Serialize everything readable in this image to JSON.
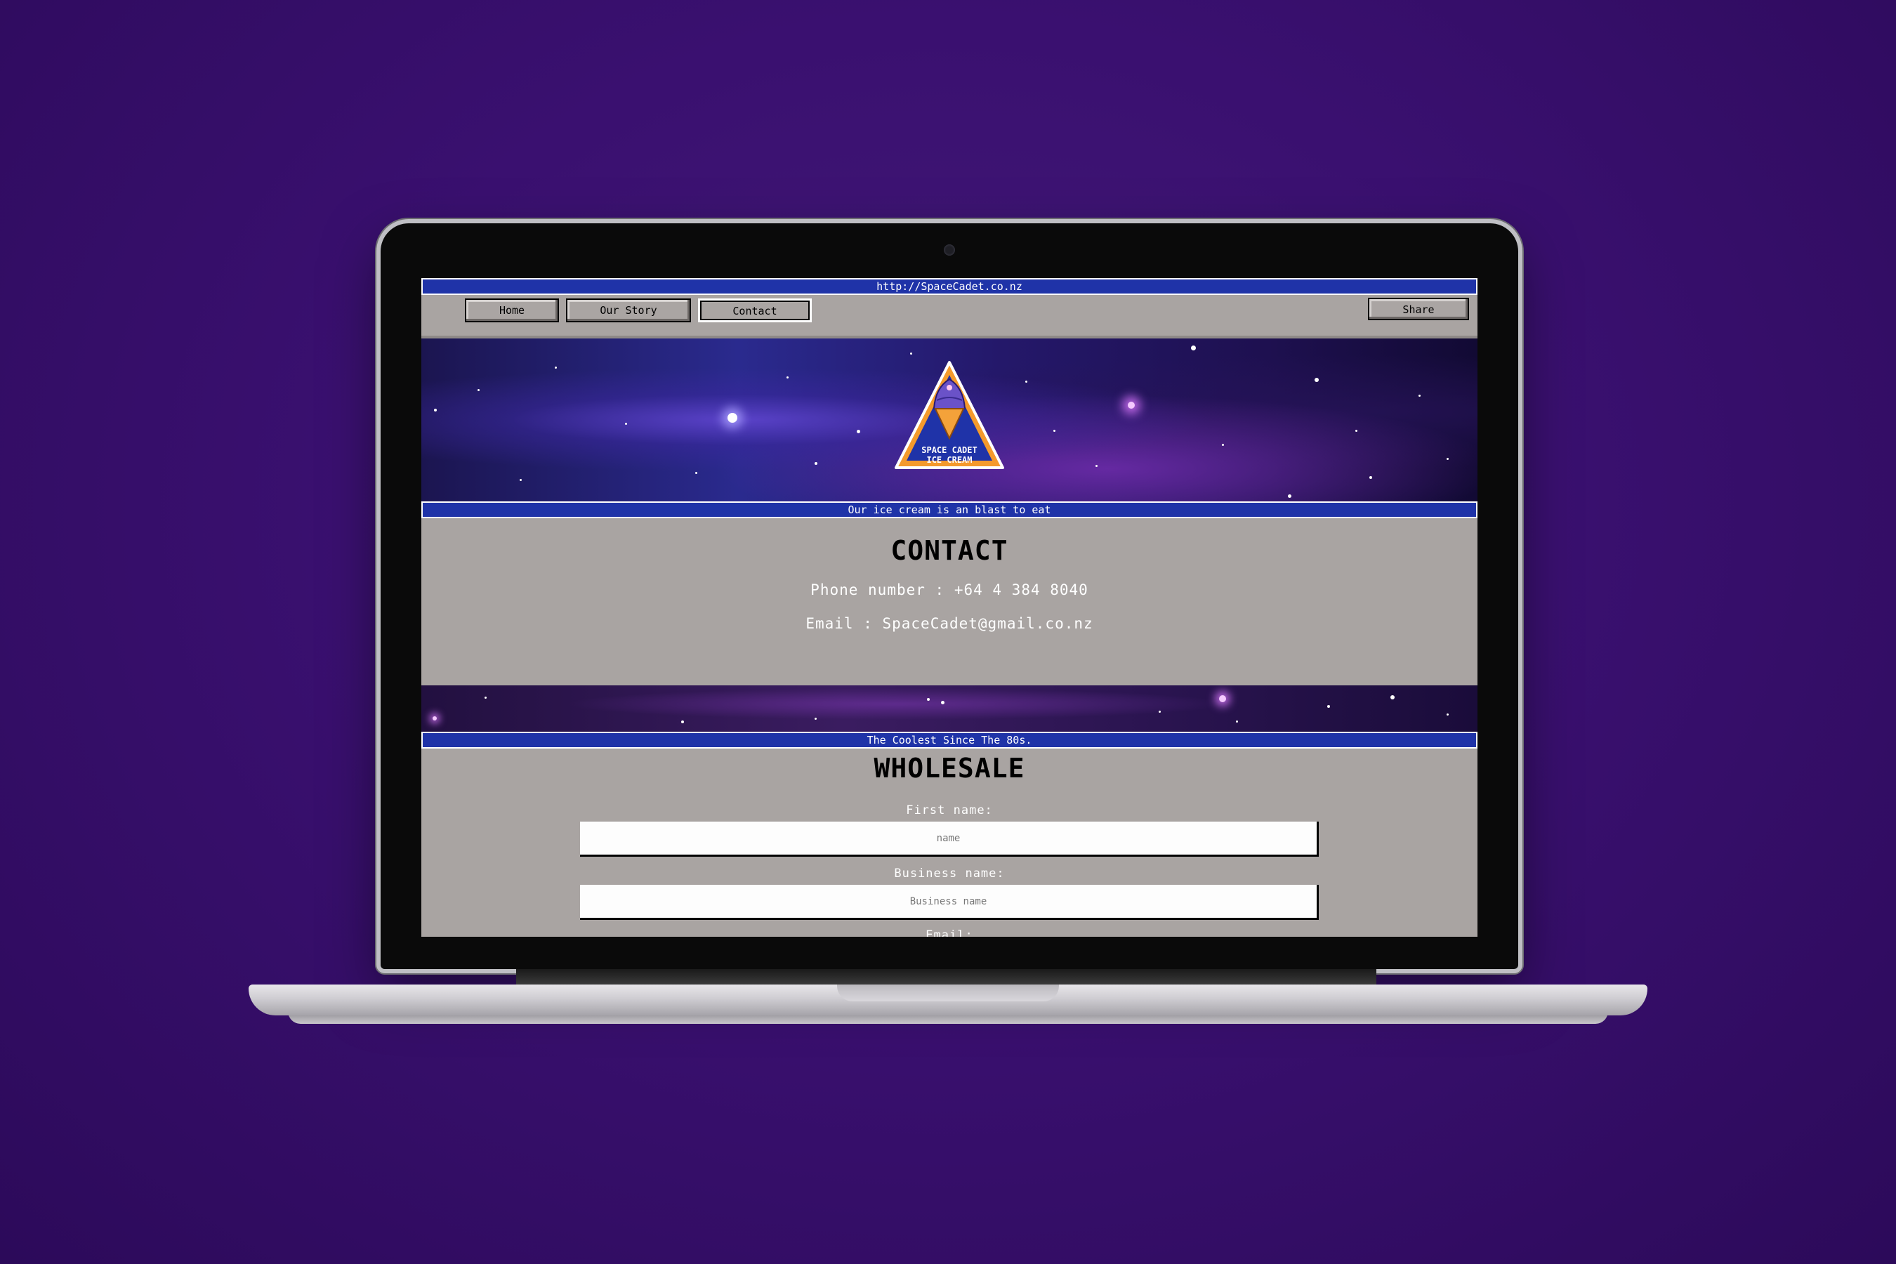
{
  "browser": {
    "url": "http://SpaceCadet.co.nz"
  },
  "nav": {
    "items": [
      "Home",
      "Our Story",
      "Contact"
    ],
    "active": "Contact",
    "share_label": "Share"
  },
  "logo": {
    "line1": "SPACE CADET",
    "line2": "ICE CREAM"
  },
  "hero": {
    "tagline": "Our ice cream is an blast to eat"
  },
  "contact": {
    "title": "CONTACT",
    "phone": "Phone number : +64 4 384 8040",
    "email": "Email : SpaceCadet@gmail.co.nz"
  },
  "banner2": {
    "tagline": "The Coolest Since The 80s."
  },
  "wholesale": {
    "title": "WHOLESALE",
    "fields": [
      {
        "label": "First name:",
        "placeholder": "name"
      },
      {
        "label": "Business name:",
        "placeholder": "Business name"
      }
    ],
    "next_label_partial": "Email:"
  },
  "colors": {
    "accent_blue": "#1f33a8",
    "panel_grey": "#a9a4a2",
    "background_purple": "#3a1070"
  },
  "icons": [
    "webcam-icon",
    "ice-cream-rocket-logo"
  ]
}
